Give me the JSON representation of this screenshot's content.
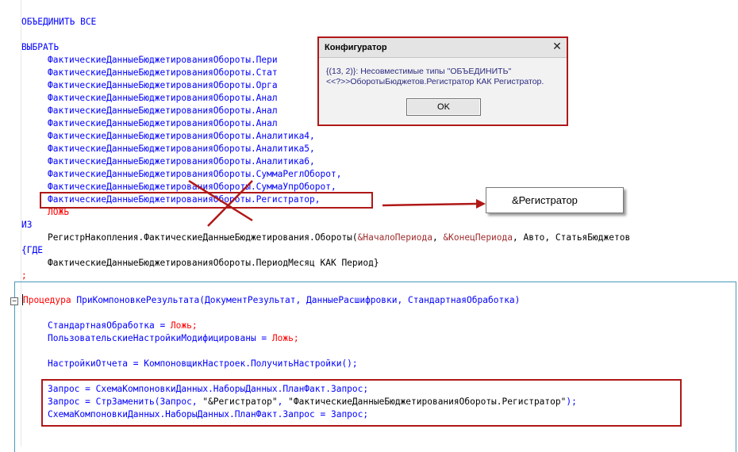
{
  "code": {
    "union_all": "ОБЪЕДИНИТЬ ВСЕ",
    "select": "ВЫБРАТЬ",
    "select_fields": [
      "ФактическиеДанныеБюджетированияОбороты.Пери",
      "ФактическиеДанныеБюджетированияОбороты.Стат",
      "ФактическиеДанныеБюджетированияОбороты.Орга",
      "ФактическиеДанныеБюджетированияОбороты.Анал",
      "ФактическиеДанныеБюджетированияОбороты.Анал",
      "ФактическиеДанныеБюджетированияОбороты.Анал",
      "ФактическиеДанныеБюджетированияОбороты.Аналитика4,",
      "ФактическиеДанныеБюджетированияОбороты.Аналитика5,",
      "ФактическиеДанныеБюджетированияОбороты.Аналитика6,",
      "ФактическиеДанныеБюджетированияОбороты.СуммаРеглОборот,",
      "ФактическиеДанныеБюджетированияОбороты.СуммаУпрОборот,",
      "ФактическиеДанныеБюджетированияОбороты.Регистратор,"
    ],
    "false_kw": "ЛОЖЬ",
    "from": "ИЗ",
    "from_source_start": "РегистрНакопления.ФактическиеДанныеБюджетирования.Обороты(",
    "param_start": "&НачалоПериода",
    "param_end": "&КонецПериода",
    "from_source_rest": ", Авто, СтатьяБюджетов",
    "where": "{ГДЕ",
    "where_field": "ФактическиеДанныеБюджетированияОбороты.ПериодМесяц КАК Период}",
    "semicolon": ";",
    "proc_kw": "Процедура",
    "proc_rest": " ПриКомпоновкеРезультата(ДокументРезультат, ДанныеРасшифровки, СтандартнаяОбработка)",
    "line_std_a": "СтандартнаяОбработка = ",
    "line_std_b": "Ложь",
    "line_std_c": ";",
    "line_user_a": "ПользовательскиеНастройкиМодифицированы = ",
    "line_user_b": "Ложь",
    "line_user_c": ";",
    "line_settings": "НастройкиОтчета = КомпоновщикНастроек.ПолучитьНастройки();",
    "line_query1": "Запрос = СхемаКомпоновкиДанных.НаборыДанных.ПланФакт.Запрос;",
    "line_query2_a": "Запрос = СтрЗаменить(Запрос, ",
    "line_query2_str1": "\"&Регистратор\"",
    "line_query2_mid": ", ",
    "line_query2_str2": "\"ФактическиеДанныеБюджетированияОбороты.Регистратор\"",
    "line_query2_end": ");",
    "line_query3": "СхемаКомпоновкиДанных.НаборыДанных.ПланФакт.Запрос = Запрос;"
  },
  "dialog": {
    "title": "Конфигуратор",
    "message_line1": "{(13, 2)}: Несовместимые типы \"ОБЪЕДИНИТЬ\"",
    "message_line2": "<<?>>ОборотыБюджетов.Регистратор КАК Регистратор.",
    "ok_label": "OK"
  },
  "callout": {
    "text": "&Регистратор"
  },
  "colors": {
    "keyword": "#ff0000",
    "identifier": "#0000ff",
    "highlight_border": "#b01818",
    "frame": "#4a9ab8"
  }
}
